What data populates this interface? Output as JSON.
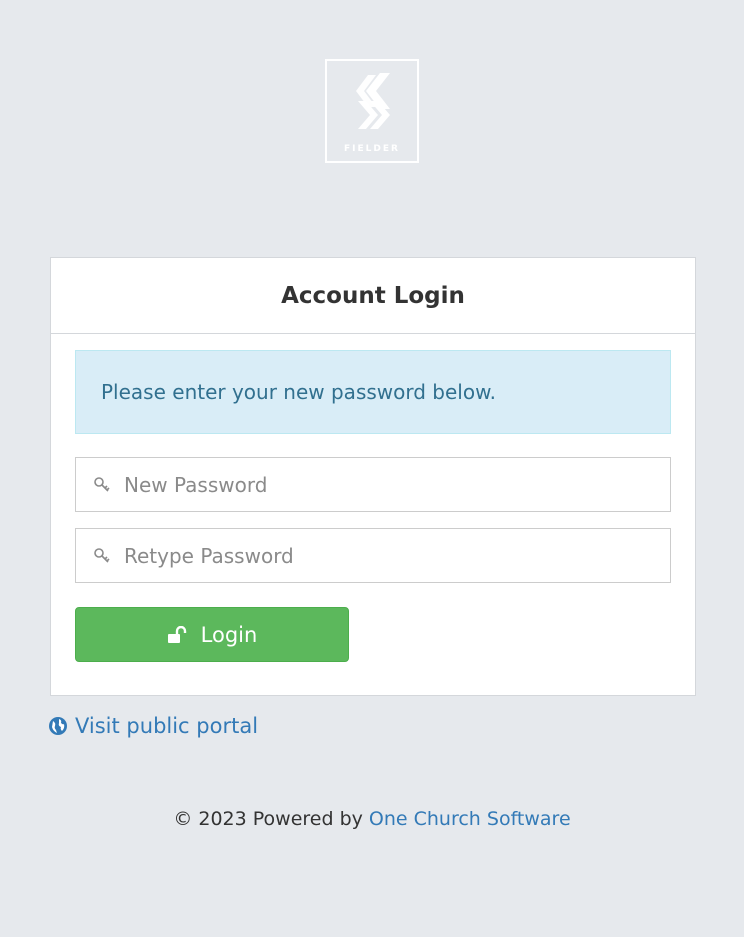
{
  "logo": {
    "text": "FIELDER",
    "color": "#ffffff"
  },
  "card": {
    "title": "Account Login",
    "alert_text": "Please enter your new password below.",
    "new_password": {
      "placeholder": "New Password",
      "value": "",
      "icon": "key-icon"
    },
    "retype_password": {
      "placeholder": "Retype Password",
      "value": "",
      "icon": "key-icon"
    },
    "login_button": {
      "label": "Login",
      "icon": "unlock-icon",
      "color": "#5cb85c"
    }
  },
  "portal_link": {
    "label": "Visit public portal",
    "icon": "globe-icon",
    "color": "#337ab7"
  },
  "footer": {
    "prefix": "© 2023 Powered by",
    "link_label": "One Church Software"
  },
  "colors": {
    "background": "#e6e9ed",
    "alert_bg": "#d9edf7",
    "alert_text": "#31708f",
    "link": "#337ab7"
  }
}
